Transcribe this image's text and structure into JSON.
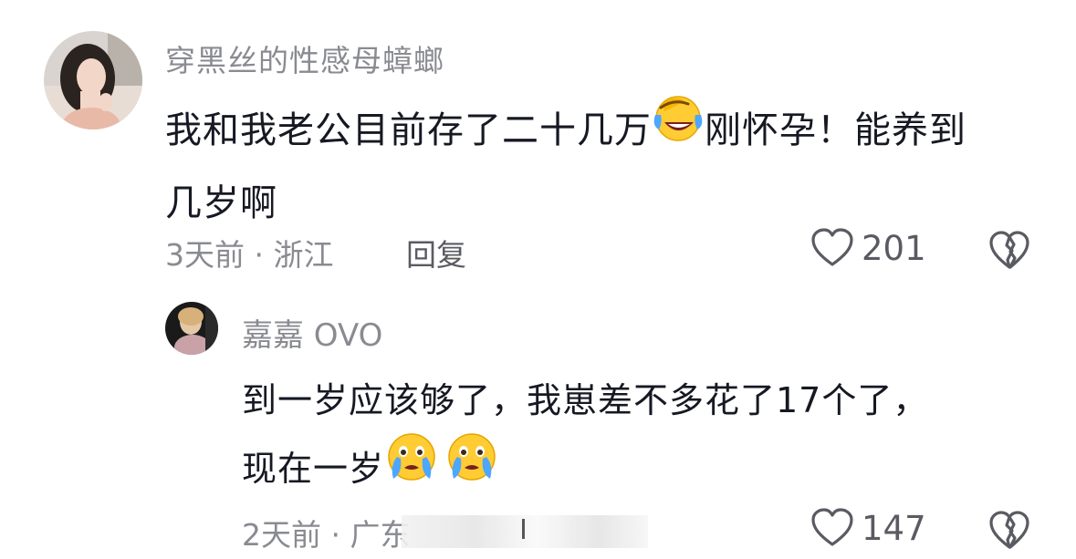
{
  "comment": {
    "username": "穿黑丝的性感母蟑螂",
    "body_line1_a": "我和我老公目前存了二十几万",
    "body_line1_b": "刚怀孕！能养到",
    "body_line2": "几岁啊",
    "emoji": "laughing-crying-face-icon",
    "time_location": "3天前 · 浙江",
    "reply_label": "回复",
    "like_count": "201"
  },
  "reply": {
    "username": "嘉嘉 OVO",
    "body_line1": "到一岁应该够了，我崽差不多花了17个了，",
    "body_line2": "现在一岁",
    "emojis": [
      "crying-face-icon",
      "crying-face-icon"
    ],
    "time_location": "2天前 · 广东",
    "like_count": "147"
  },
  "colors": {
    "text": "#161823",
    "secondary": "#8a8b91",
    "icon": "#5a5b62"
  }
}
